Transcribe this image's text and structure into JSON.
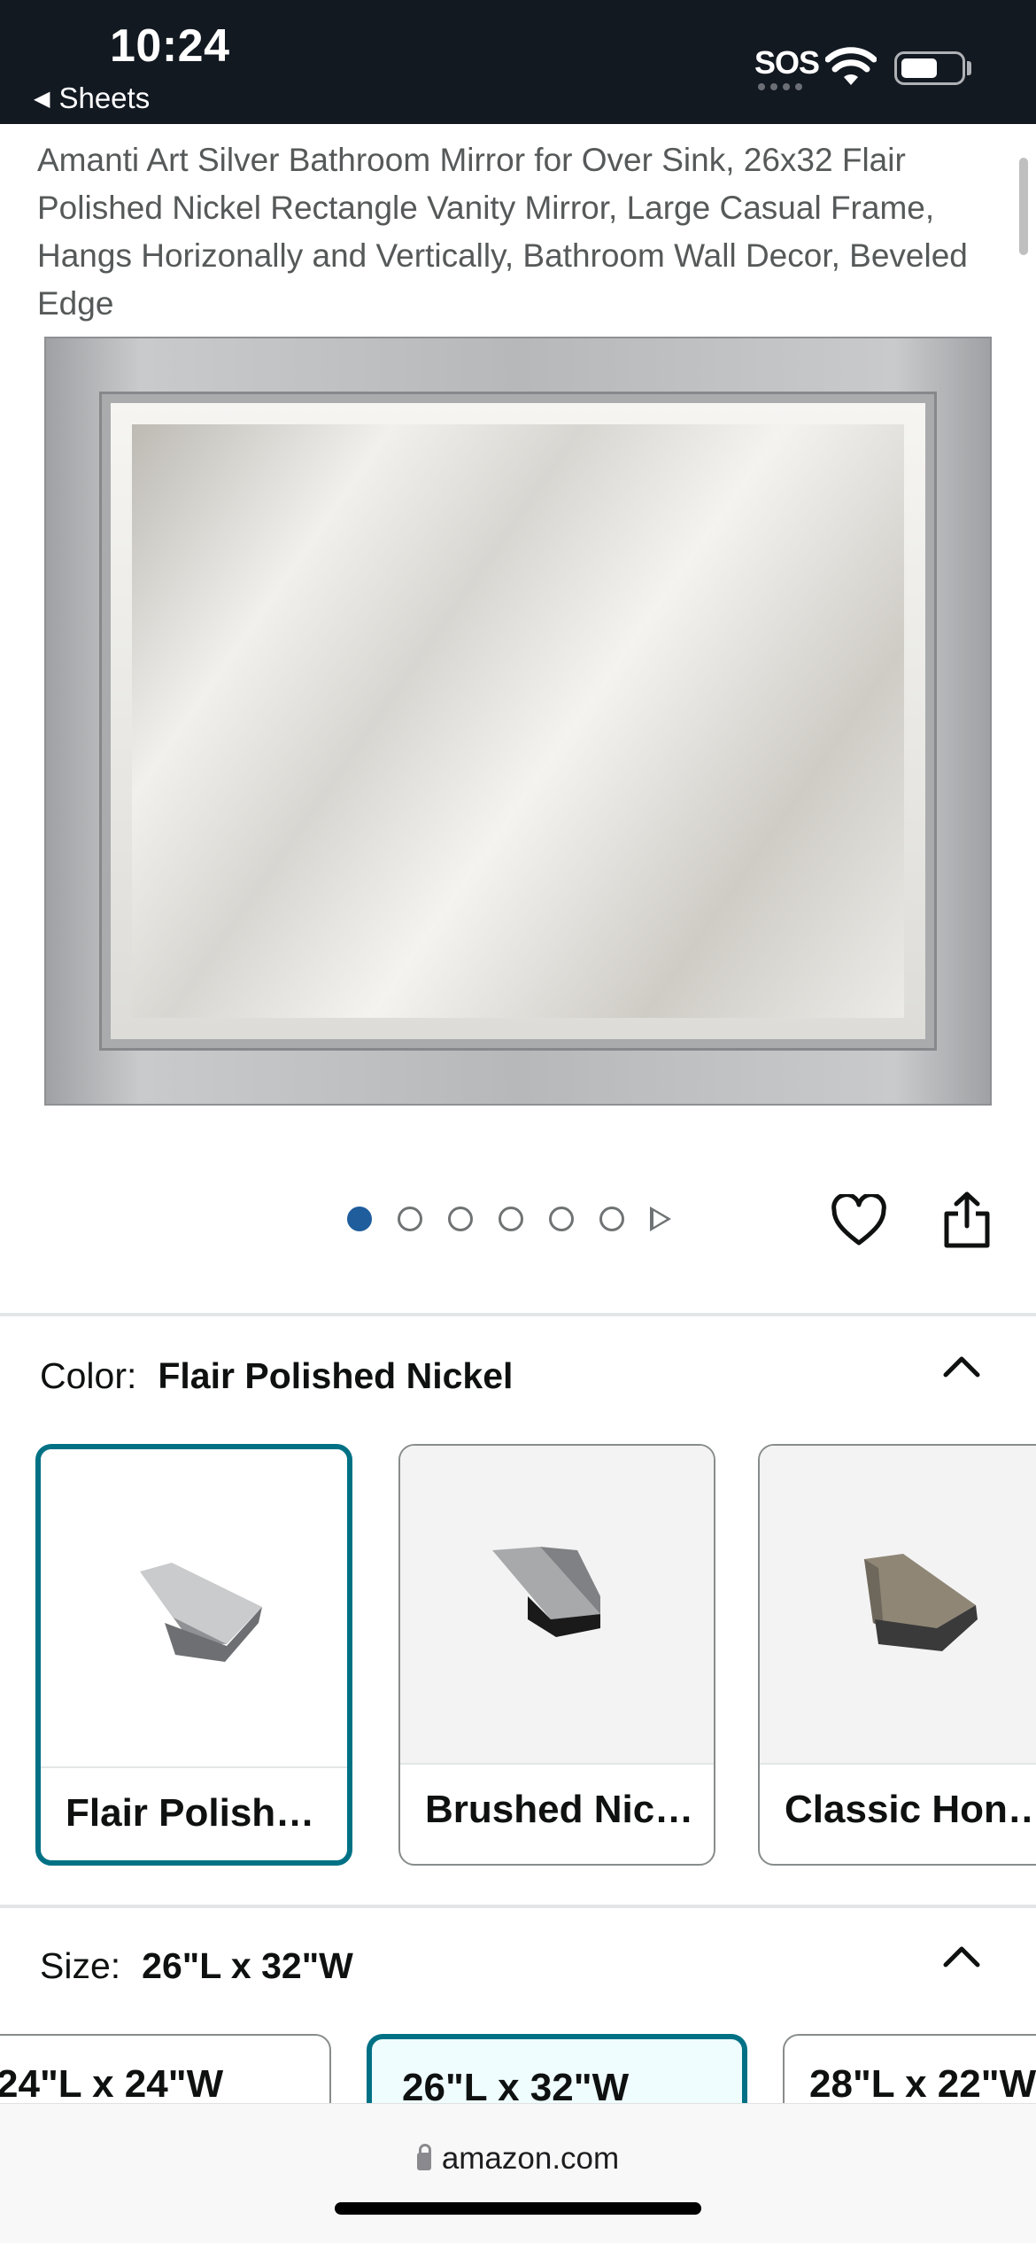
{
  "status_bar": {
    "time": "10:24",
    "back_app": "Sheets",
    "sos": "SOS",
    "icons": [
      "wifi-icon",
      "battery-icon"
    ]
  },
  "product": {
    "title": "Amanti Art Silver Bathroom Mirror for Over Sink, 26x32 Flair Polished Nickel Rectangle Vanity Mirror, Large Casual Frame, Hangs Horizonally and Vertically, Bathroom Wall Decor, Beveled Edge"
  },
  "carousel": {
    "total_images": 6,
    "active_index": 0,
    "has_video": true
  },
  "color": {
    "label": "Color:",
    "selected": "Flair Polished Nickel",
    "options": [
      {
        "label": "Flair Polish…",
        "selected": true
      },
      {
        "label": "Brushed Nic…",
        "selected": false
      },
      {
        "label": "Classic Hon…",
        "selected": false
      }
    ]
  },
  "size": {
    "label": "Size:",
    "selected": "26\"L x 32\"W",
    "options": [
      {
        "label": "24\"L x 24\"W",
        "selected": false
      },
      {
        "label": "26\"L x 32\"W",
        "selected": true
      },
      {
        "label": "28\"L x 22\"W",
        "selected": false
      }
    ]
  },
  "browser": {
    "url": "amazon.com"
  },
  "colors": {
    "status_bar_bg": "#131921",
    "selected_border": "#007185",
    "active_dot": "#1f5d9c",
    "title_text": "#565959"
  }
}
